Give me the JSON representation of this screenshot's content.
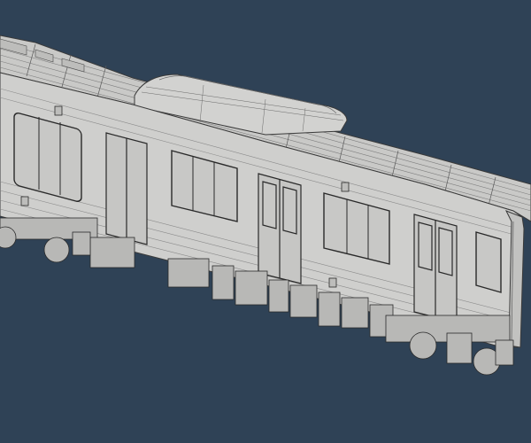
{
  "scene": {
    "background": "#2f4256",
    "subject": "train-car-3d-render",
    "colors": {
      "body": "#cfcfcd",
      "body_shade": "#bdbdbb",
      "roof": "#c9c9c7",
      "roof_dark": "#b5b5b3",
      "line": "#3a3a3a",
      "line_light": "#8a8a8a",
      "window": "#c4c4c2",
      "undercarriage": "#b8b8b6"
    }
  }
}
